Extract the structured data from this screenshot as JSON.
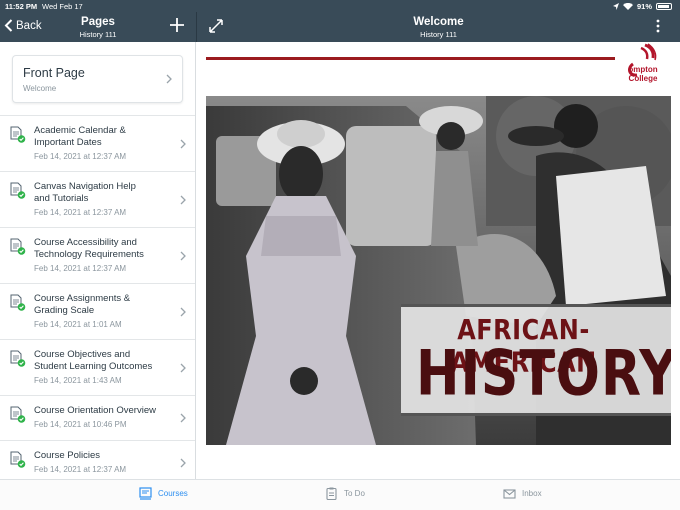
{
  "status": {
    "time": "11:52 PM",
    "date": "Wed Feb 17",
    "battery": "91%",
    "battery_level": 0.91
  },
  "left_header": {
    "back_label": "Back",
    "title": "Pages",
    "subtitle": "History 111"
  },
  "right_header": {
    "title": "Welcome",
    "subtitle": "History 111"
  },
  "front_page": {
    "title": "Front Page",
    "subtitle": "Welcome"
  },
  "pages": [
    {
      "line1": "Academic Calendar &",
      "line2": "Important Dates",
      "date": "Feb 14, 2021 at 12:37 AM"
    },
    {
      "line1": "Canvas Navigation Help",
      "line2": "and Tutorials",
      "date": "Feb 14, 2021 at 12:37 AM"
    },
    {
      "line1": "Course Accessibility and",
      "line2": "Technology Requirements",
      "date": "Feb 14, 2021 at 12:37 AM"
    },
    {
      "line1": "Course Assignments &",
      "line2": "Grading Scale",
      "date": "Feb 14, 2021 at 1:01 AM"
    },
    {
      "line1": "Course Objectives and",
      "line2": "Student Learning Outcomes",
      "date": "Feb 14, 2021 at 1:43 AM"
    },
    {
      "line1": "Course Orientation Overview",
      "line2": "",
      "date": "Feb 14, 2021 at 10:46 PM"
    },
    {
      "line1": "Course Policies",
      "line2": "",
      "date": "Feb 14, 2021 at 12:37 AM"
    }
  ],
  "content": {
    "logo_line1": "ompton",
    "logo_line2": "College",
    "banner_line1": "AFRICAN-AMERICAN",
    "banner_line2": "HISTORY"
  },
  "tabs": [
    {
      "label": "Courses",
      "icon": "courses-icon",
      "active": true
    },
    {
      "label": "To Do",
      "icon": "todo-icon",
      "active": false
    },
    {
      "label": "Inbox",
      "icon": "inbox-icon",
      "active": false
    }
  ],
  "colors": {
    "header": "#394b58",
    "accent": "#2d8ff0",
    "published": "#2fb34a",
    "brand_red": "#9b1b1f"
  }
}
